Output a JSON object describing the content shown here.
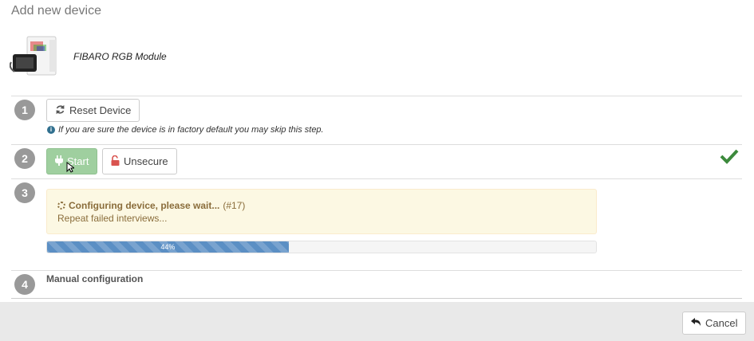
{
  "header": {
    "title": "Add new device"
  },
  "device": {
    "name": "FIBARO RGB Module"
  },
  "steps": [
    {
      "number": "1",
      "button_label": "Reset Device",
      "info": "If you are sure the device is in factory default you may skip this step."
    },
    {
      "number": "2",
      "start_label": "Start",
      "unsecure_label": "Unsecure",
      "status": "completed"
    },
    {
      "number": "3",
      "status_title": "Configuring device, please wait...",
      "status_id": "(#17)",
      "status_detail": "Repeat failed interviews...",
      "progress_value": 44,
      "progress_label": "44%"
    },
    {
      "number": "4",
      "title": "Manual configuration"
    }
  ],
  "footer": {
    "cancel_label": "Cancel"
  },
  "colors": {
    "success": "#3c8a3c",
    "info": "#31708f",
    "warning_bg": "#fcf8e3",
    "progress": "#5b8fc4",
    "start_button": "#9fcf9f",
    "unsecure_icon": "#d9534f"
  },
  "icons": {
    "reset": "refresh-icon",
    "info": "info-circle-icon",
    "start": "plug-icon",
    "unsecure": "unlock-icon",
    "check": "check-icon",
    "spinner": "spinner-icon",
    "cancel": "undo-arrow-icon"
  }
}
